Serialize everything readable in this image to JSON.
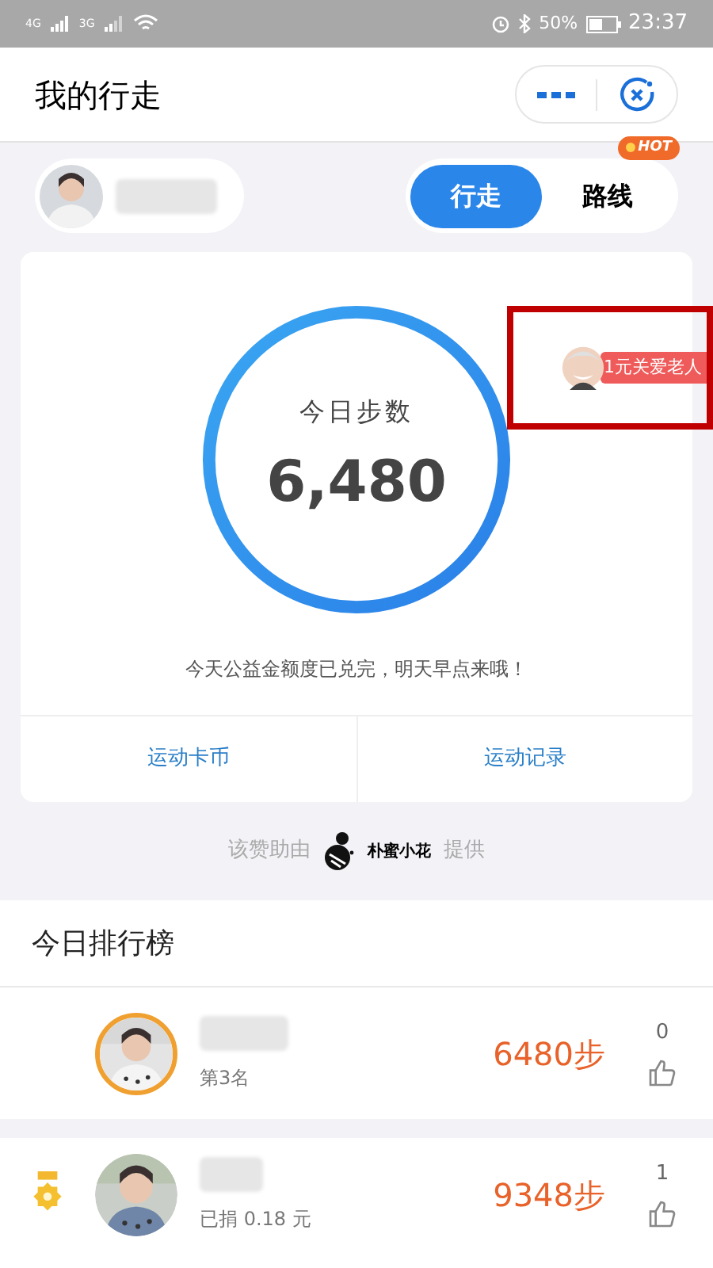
{
  "status_bar": {
    "signal_1": "4G",
    "signal_2": "3G",
    "battery": "50%",
    "time": "23:37"
  },
  "header": {
    "title": "我的行走"
  },
  "mode_tabs": [
    {
      "label": "行走",
      "selected": true
    },
    {
      "label": "路线",
      "selected": false,
      "badge": "HOT"
    }
  ],
  "steps_card": {
    "label": "今日步数",
    "value": "6,480",
    "promo": "1元关爱老人",
    "notice": "今天公益金额度已兑完，明天早点来哦！",
    "actions": [
      "运动卡币",
      "运动记录"
    ]
  },
  "sponsor": {
    "prefix": "该赞助由",
    "brand": "朴蜜小花",
    "suffix": "提供"
  },
  "ranking": {
    "title": "今日排行榜",
    "rows": [
      {
        "kind": "self",
        "subtitle": "第3名",
        "steps": "6480步",
        "likes": "0"
      },
      {
        "kind": "medal",
        "subtitle": "已捐 0.18 元",
        "steps": "9348步",
        "likes": "1"
      }
    ]
  }
}
